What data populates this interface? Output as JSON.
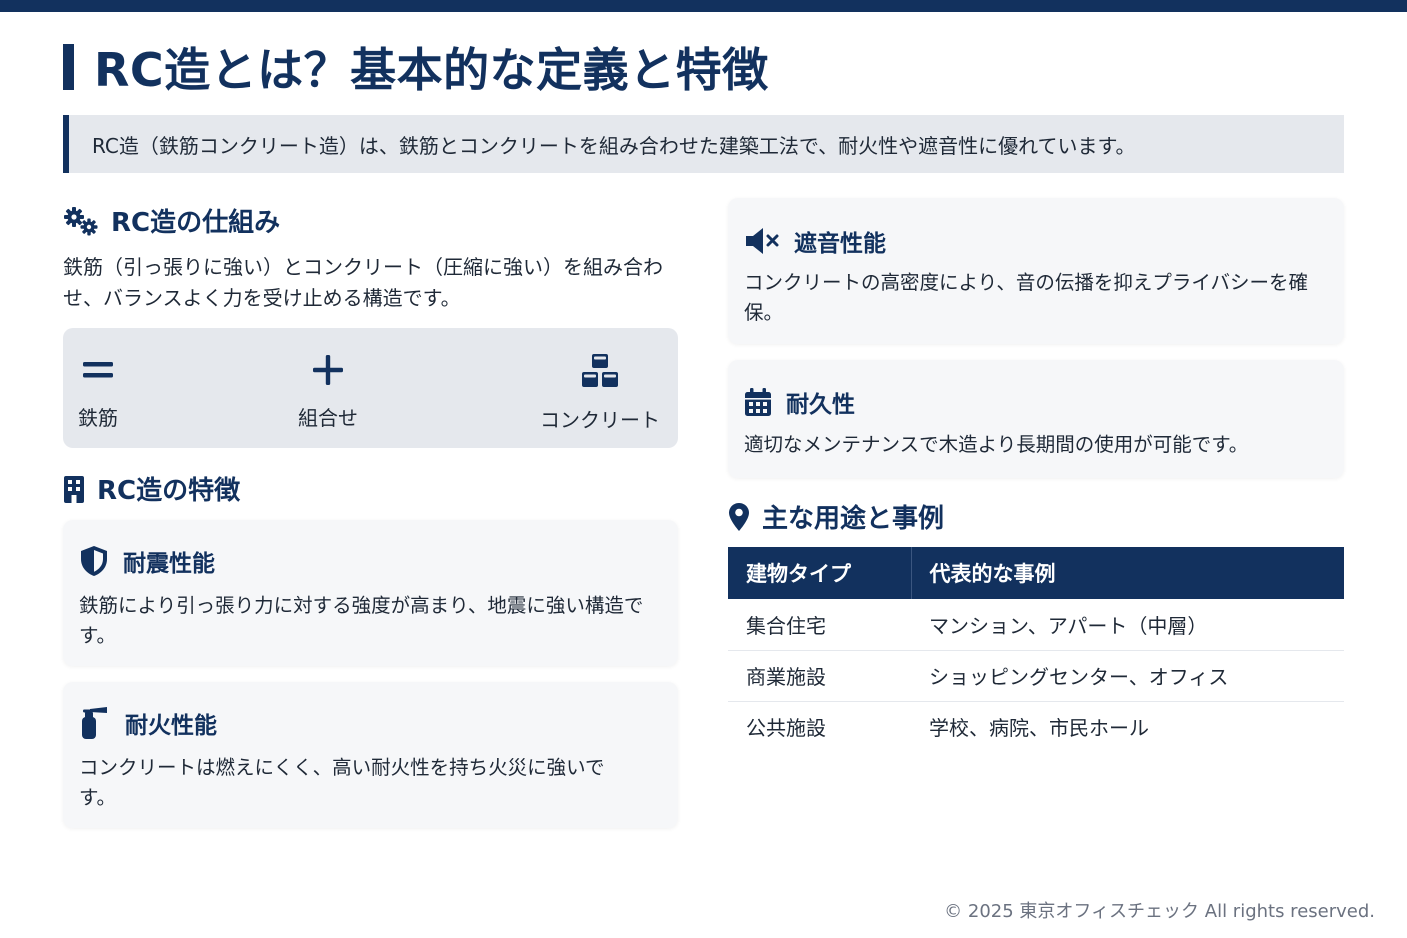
{
  "header": {
    "title": "RC造とは？基本的な定義と特徴",
    "intro": "RC造（鉄筋コンクリート造）は、鉄筋とコンクリートを組み合わせた建築工法で、耐火性や遮音性に優れています。"
  },
  "mechanism": {
    "heading": "RC造の仕組み",
    "icon": "gears-icon",
    "text": "鉄筋（引っ張りに強い）とコンクリート（圧縮に強い）を組み合わせ、バランスよく力を受け止める構造です。",
    "items": [
      {
        "icon": "equals-icon",
        "label": "鉄筋"
      },
      {
        "icon": "plus-icon",
        "label": "組合せ"
      },
      {
        "icon": "cubes-icon",
        "label": "コンクリート"
      }
    ]
  },
  "features": {
    "heading": "RC造の特徴",
    "icon": "building-icon",
    "cards": [
      {
        "icon": "shield-icon",
        "title": "耐震性能",
        "text": "鉄筋により引っ張り力に対する強度が高まり、地震に強い構造です。"
      },
      {
        "icon": "fire-extinguisher-icon",
        "title": "耐火性能",
        "text": "コンクリートは燃えにくく、高い耐火性を持ち火災に強いです。"
      },
      {
        "icon": "volume-mute-icon",
        "title": "遮音性能",
        "text": "コンクリートの高密度により、音の伝播を抑えプライバシーを確保。"
      },
      {
        "icon": "calendar-icon",
        "title": "耐久性",
        "text": "適切なメンテナンスで木造より長期間の使用が可能です。"
      }
    ]
  },
  "uses": {
    "heading": "主な用途と事例",
    "icon": "map-marker-icon",
    "columns": [
      "建物タイプ",
      "代表的な事例"
    ],
    "rows": [
      [
        "集合住宅",
        "マンション、アパート（中層）"
      ],
      [
        "商業施設",
        "ショッピングセンター、オフィス"
      ],
      [
        "公共施設",
        "学校、病院、市民ホール"
      ]
    ]
  },
  "footer": {
    "copyright": "© 2025 東京オフィスチェック All rights reserved."
  },
  "colors": {
    "primary": "#12315e",
    "panel": "#e5e8ed",
    "card": "#f6f7f9",
    "text": "#1f2937",
    "muted": "#6b7280"
  }
}
